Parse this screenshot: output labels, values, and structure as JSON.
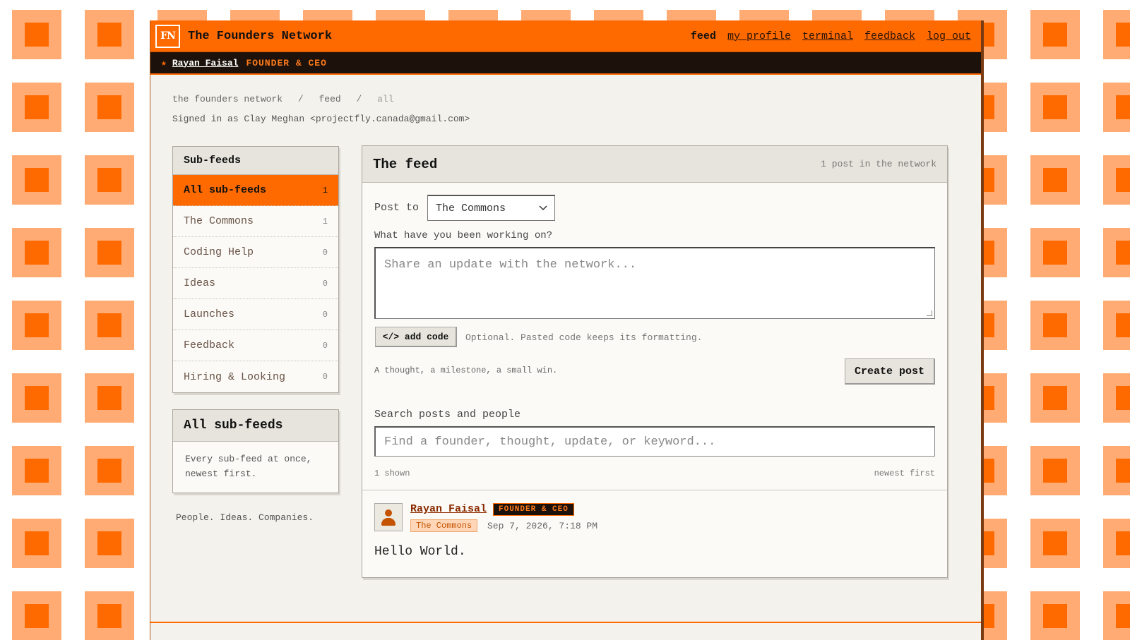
{
  "colors": {
    "accent": "#ff6a00",
    "dark": "#1c120b",
    "tile_light": "#ffab73"
  },
  "header": {
    "logo_text": "FN",
    "brand": "The Founders Network",
    "nav": [
      {
        "label": "feed"
      },
      {
        "label": "my profile"
      },
      {
        "label": "terminal"
      },
      {
        "label": "feedback"
      },
      {
        "label": "log out"
      }
    ]
  },
  "ticker": {
    "star": "★",
    "name": "Rayan Faisal",
    "role": "FOUNDER & CEO"
  },
  "breadcrumb": {
    "root": "the founders network",
    "sep": "/",
    "section": "feed",
    "current": "all"
  },
  "signed_in": "Signed in as Clay Meghan <projectfly.canada@gmail.com>",
  "sidebar": {
    "title": "Sub-feeds",
    "items": [
      {
        "label": "All sub-feeds",
        "count": "1"
      },
      {
        "label": "The Commons",
        "count": "1"
      },
      {
        "label": "Coding Help",
        "count": "0"
      },
      {
        "label": "Ideas",
        "count": "0"
      },
      {
        "label": "Launches",
        "count": "0"
      },
      {
        "label": "Feedback",
        "count": "0"
      },
      {
        "label": "Hiring & Looking",
        "count": "0"
      }
    ],
    "info_title": "All sub-feeds",
    "info_desc": "Every sub-feed at once, newest first.",
    "tagline": "People. Ideas. Companies."
  },
  "feed": {
    "title": "The feed",
    "count_text": "1 post in the network",
    "post_to_label": "Post to",
    "post_to_value": "The Commons",
    "prompt_label": "What have you been working on?",
    "textarea_placeholder": "Share an update with the network...",
    "add_code_label": "</> add code",
    "optional_text": "Optional. Pasted code keeps its formatting.",
    "hint_text": "A thought, a milestone, a small win.",
    "create_label": "Create post",
    "search_label": "Search posts and people",
    "search_placeholder": "Find a founder, thought, update, or keyword...",
    "shown_text": "1 shown",
    "sort_text": "newest first"
  },
  "posts": [
    {
      "author": "Rayan Faisal",
      "badge": "FOUNDER & CEO",
      "subfeed": "The Commons",
      "date": "Sep 7, 2026, 7:18 PM",
      "body": "Hello World.",
      "avatar_icon": "person-icon"
    }
  ]
}
